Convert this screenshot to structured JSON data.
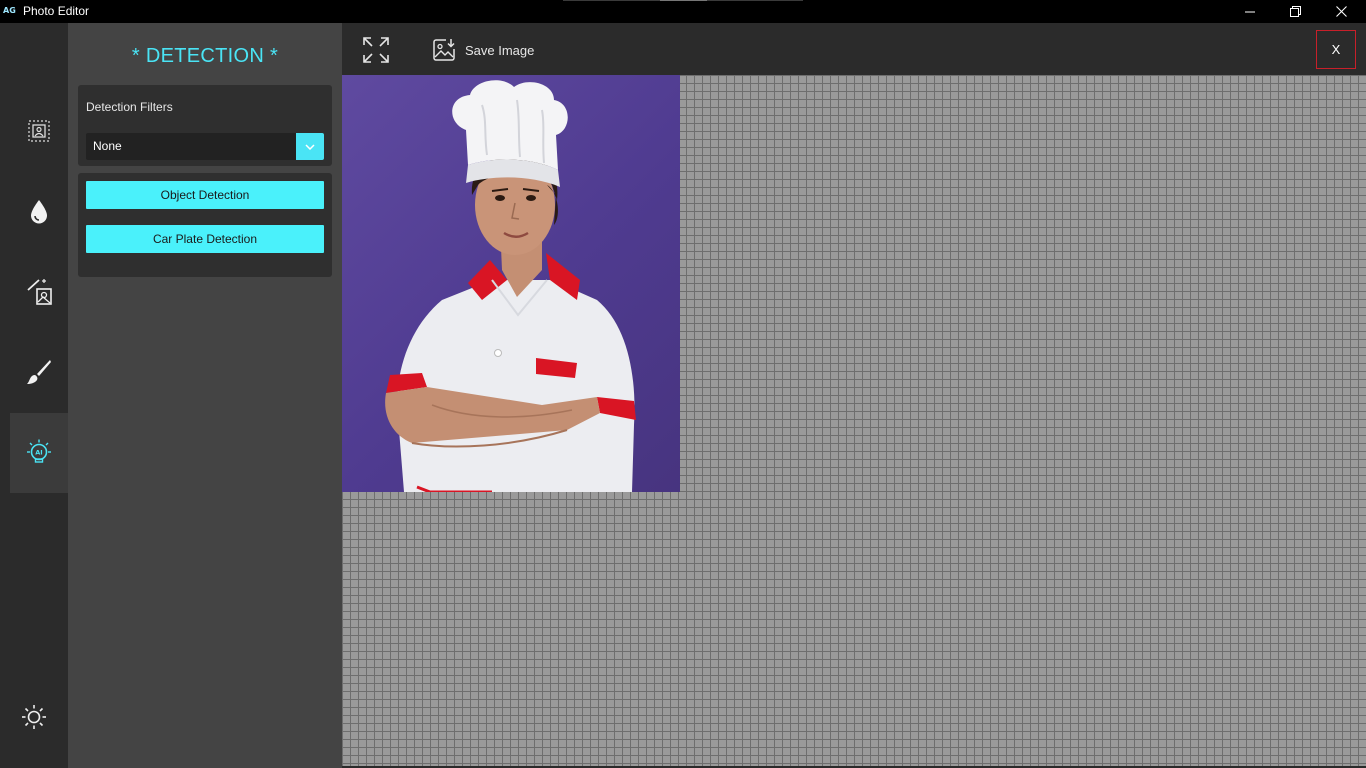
{
  "window": {
    "app_icon_text": "AG",
    "title": "Photo Editor"
  },
  "rail": {
    "items": [
      {
        "name": "crop-frame-icon",
        "active": false
      },
      {
        "name": "color-drop-icon",
        "active": false
      },
      {
        "name": "magic-edit-icon",
        "active": false
      },
      {
        "name": "brush-icon",
        "active": false
      },
      {
        "name": "ai-bulb-icon",
        "active": true
      }
    ],
    "bottom_icon": "brightness-icon"
  },
  "panel": {
    "title": "* DETECTION *",
    "filters_label": "Detection Filters",
    "filter_value": "None",
    "buttons": {
      "object_detection": "Object Detection",
      "car_plate_detection": "Car Plate Detection"
    }
  },
  "toolbar": {
    "save_label": "Save Image",
    "close_label": "X"
  },
  "canvas": {
    "image_subject": "chef-woman-photo"
  },
  "colors": {
    "accent": "#4ae4f5",
    "button": "#4af1fb",
    "close_border": "#c8202a",
    "photo_bg": "#5a4599"
  }
}
